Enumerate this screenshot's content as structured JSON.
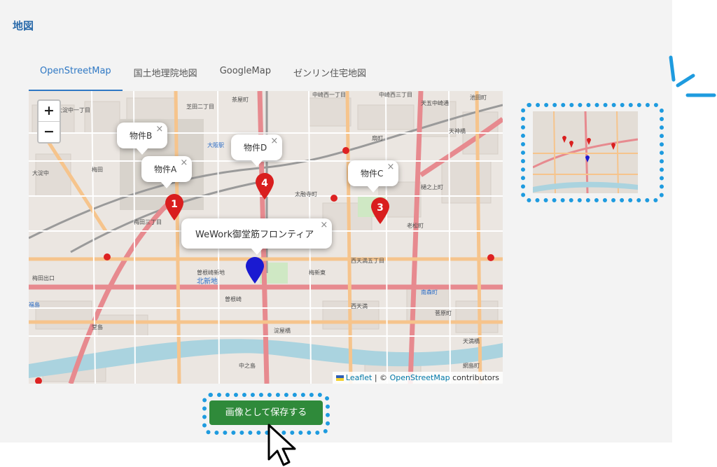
{
  "section": {
    "title": "地図"
  },
  "tabs": [
    {
      "label": "OpenStreetMap",
      "active": true
    },
    {
      "label": "国土地理院地図",
      "active": false
    },
    {
      "label": "GoogleMap",
      "active": false
    },
    {
      "label": "ゼンリン住宅地図",
      "active": false
    }
  ],
  "map": {
    "zoom_in": "+",
    "zoom_out": "−",
    "popups": {
      "b": "物件B",
      "a": "物件A",
      "d": "物件D",
      "c": "物件C",
      "office": "WeWork御堂筋フロンティア"
    },
    "close_glyph": "×",
    "markers": {
      "m1": "1",
      "m3": "3",
      "m4": "4"
    },
    "labels": [
      "大淀中一丁目",
      "芝田二丁目",
      "茶屋町",
      "中崎西一丁目",
      "中崎西三丁目",
      "池田町",
      "天神橋",
      "大淀中",
      "梅田",
      "太融寺町",
      "扇町",
      "西天満",
      "老松町",
      "梅田三丁目",
      "曽根崎新地",
      "北新地",
      "堂島",
      "福島",
      "中之島",
      "天満橋",
      "梅田出口",
      "西天満五丁目",
      "南森町",
      "大阪駅",
      "天五中崎通",
      "樋之上町",
      "菅原町",
      "曽根崎",
      "梅新東",
      "淀屋橋",
      "網島町"
    ],
    "attribution": {
      "leaflet": "Leaflet",
      "sep": "| ©",
      "osm": "OpenStreetMap",
      "contributors": "contributors"
    }
  },
  "actions": {
    "save_image": "画像として保存する"
  },
  "colors": {
    "accent": "#2f78c4",
    "save_button": "#2f8a3a",
    "highlight": "#1e9bdf",
    "marker_red": "#d91e1e",
    "marker_blue": "#1a1ad1"
  }
}
